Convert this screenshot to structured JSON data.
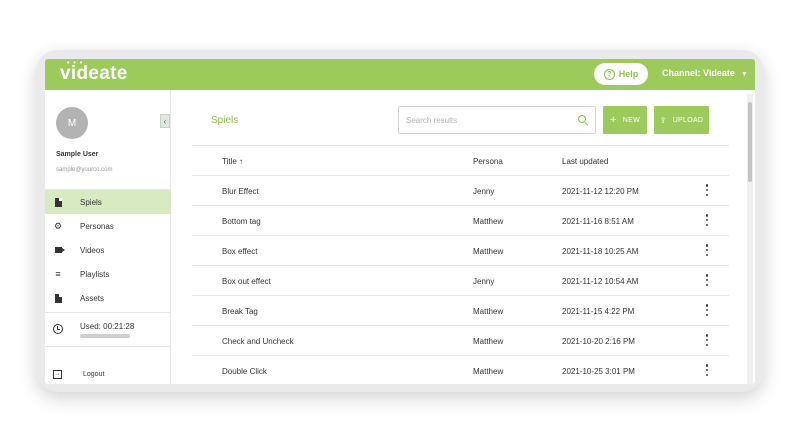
{
  "header": {
    "logo": "videate",
    "help_label": "Help",
    "channel_label": "Channel: Videate"
  },
  "user": {
    "avatar_initial": "M",
    "name": "Sample User",
    "email": "sample@yourco.com"
  },
  "sidebar": {
    "items": [
      {
        "label": "Spiels",
        "icon": "document-icon",
        "active": true
      },
      {
        "label": "Personas",
        "icon": "gear-icon",
        "active": false
      },
      {
        "label": "Videos",
        "icon": "video-camera-icon",
        "active": false
      },
      {
        "label": "Playlists",
        "icon": "playlist-icon",
        "active": false
      },
      {
        "label": "Assets",
        "icon": "file-icon",
        "active": false
      }
    ],
    "usage_label": "Used: 00:21:28",
    "logout_label": "Logout"
  },
  "main": {
    "title": "Spiels",
    "search_placeholder": "Search results",
    "new_label": "NEW",
    "upload_label": "UPLOAD",
    "columns": {
      "title": "Title ↑",
      "persona": "Persona",
      "updated": "Last updated"
    },
    "rows": [
      {
        "title": "Blur Effect",
        "persona": "Jenny",
        "updated": "2021-11-12 12:20 PM"
      },
      {
        "title": "Bottom tag",
        "persona": "Matthew",
        "updated": "2021-11-16 8:51 AM"
      },
      {
        "title": "Box effect",
        "persona": "Matthew",
        "updated": "2021-11-18 10:25 AM"
      },
      {
        "title": "Box out effect",
        "persona": "Jenny",
        "updated": "2021-11-12 10:54 AM"
      },
      {
        "title": "Break Tag",
        "persona": "Matthew",
        "updated": "2021-11-15 4:22 PM"
      },
      {
        "title": "Check and Uncheck",
        "persona": "Matthew",
        "updated": "2021-10-20 2:16 PM"
      },
      {
        "title": "Double Click",
        "persona": "Matthew",
        "updated": "2021-10-25 3:01 PM"
      }
    ]
  },
  "colors": {
    "brand_green": "#9ccb5c",
    "active_nav": "#d8ebc0"
  }
}
